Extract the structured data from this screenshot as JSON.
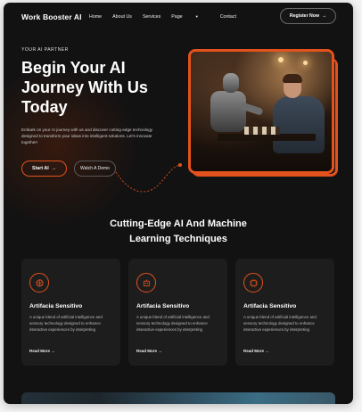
{
  "nav": {
    "logo": "Work Booster AI",
    "items": [
      "Home",
      "About Us",
      "Services",
      "Page",
      "Contact"
    ],
    "register": "Register Now"
  },
  "hero": {
    "eyebrow": "YOUR AI PARTNER",
    "title": "Begin Your AI Journey With Us Today",
    "description": "Embark on your AI journey with us and discover cutting-edge technology designed to transform your ideas into intelligent solutions. Let's innovate together!",
    "primary_button": "Start AI",
    "secondary_button": "Watch A Demo"
  },
  "section": {
    "title": "Cutting-Edge AI And Machine Learning Techniques"
  },
  "cards": [
    {
      "title": "Artifacia Sensitivo",
      "description": "A unique blend of artificial intelligence and sensory technology designed to enhance interactive experiences by interpreting",
      "link": "Read More"
    },
    {
      "title": "Artifacia Sensitivo",
      "description": "A unique blend of artificial intelligence and sensory technology designed to enhance interactive experiences by interpreting",
      "link": "Read More"
    },
    {
      "title": "Artifacia Sensitivo",
      "description": "A unique blend of artificial intelligence and sensory technology designed to enhance interactive experiences by interpreting",
      "link": "Read More"
    }
  ],
  "colors": {
    "accent": "#e3521c",
    "background": "#121212",
    "card": "#1d1d1d"
  }
}
